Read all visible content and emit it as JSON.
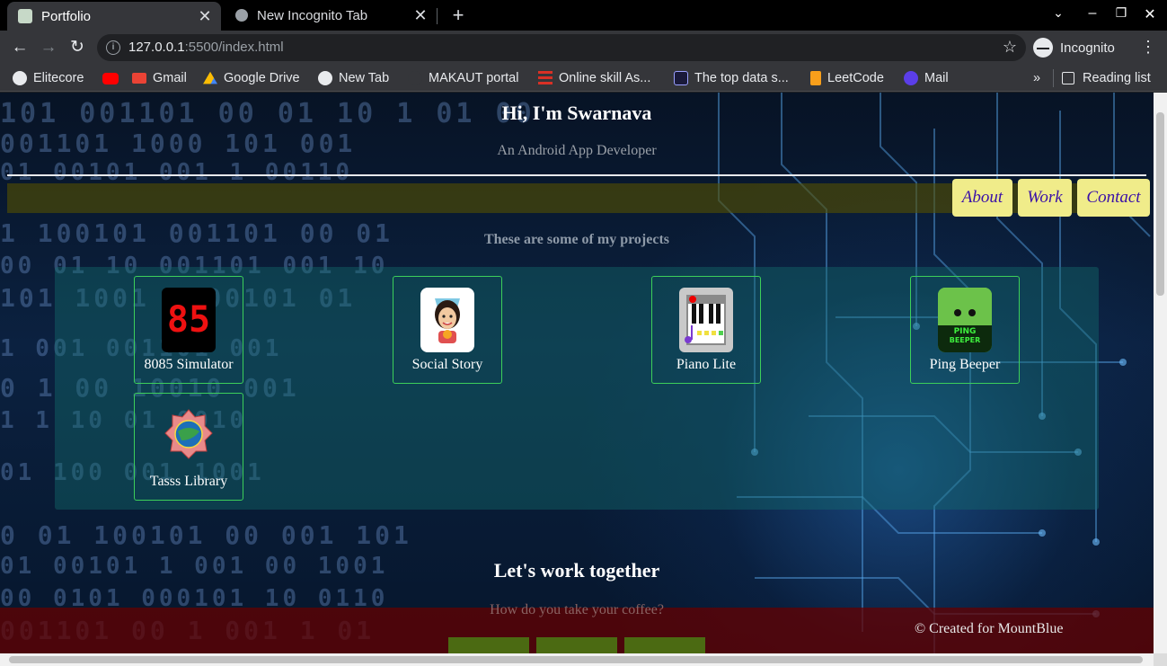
{
  "browser": {
    "tabs": [
      {
        "title": "Portfolio",
        "active": true
      },
      {
        "title": "New Incognito Tab",
        "active": false
      }
    ],
    "url_host": "127.0.0.1",
    "url_path": ":5500/index.html",
    "profile_label": "Incognito",
    "bookmarks": [
      {
        "label": "Elitecore",
        "icon": "globe-icon",
        "color": "#e8eaed"
      },
      {
        "label": "",
        "icon": "youtube-icon",
        "color": "#ff0000"
      },
      {
        "label": "Gmail",
        "icon": "gmail-icon",
        "color": "#ea4335"
      },
      {
        "label": "Google Drive",
        "icon": "drive-icon",
        "color": "#fbbc04"
      },
      {
        "label": "New Tab",
        "icon": "globe-icon",
        "color": "#e8eaed"
      },
      {
        "label": "MAKAUT portal",
        "icon": "blank-icon",
        "color": "#35363a"
      },
      {
        "label": "Online skill As...",
        "icon": "menu-icon",
        "color": "#d93025"
      },
      {
        "label": "The top data s...",
        "icon": "code-icon",
        "color": "#1a1a3a"
      },
      {
        "label": "LeetCode",
        "icon": "leetcode-icon",
        "color": "#f89f1b"
      },
      {
        "label": "Mail",
        "icon": "mail-icon",
        "color": "#5b3ee8"
      }
    ],
    "more_label": "»",
    "reading_list_label": "Reading list"
  },
  "page": {
    "hero_title": "Hi, I'm Swarnava",
    "hero_subtitle": "An Android App Developer",
    "nav": {
      "about": "About",
      "work": "Work",
      "contact": "Contact"
    },
    "projects_heading": "These are some of my projects",
    "projects": [
      {
        "name": "8085 Simulator",
        "icon": "simulator-icon"
      },
      {
        "name": "Social Story",
        "icon": "social-story-icon"
      },
      {
        "name": "Piano Lite",
        "icon": "piano-icon"
      },
      {
        "name": "Ping Beeper",
        "icon": "ping-beeper-icon"
      },
      {
        "name": "Tasss Library",
        "icon": "tasss-library-icon"
      }
    ],
    "simulator_digits": "85",
    "ping_icon_text_1": "PING",
    "ping_icon_text_2": "BEEPER",
    "work_title": "Let's work together",
    "coffee_text": "How do you take your coffee?",
    "credit": "© Created for MountBlue"
  },
  "colors": {
    "nav_button_bg": "#f0ec8a",
    "nav_button_text": "#3a10a8",
    "card_border": "#3ccf5a",
    "footer_bg": "#640000"
  }
}
